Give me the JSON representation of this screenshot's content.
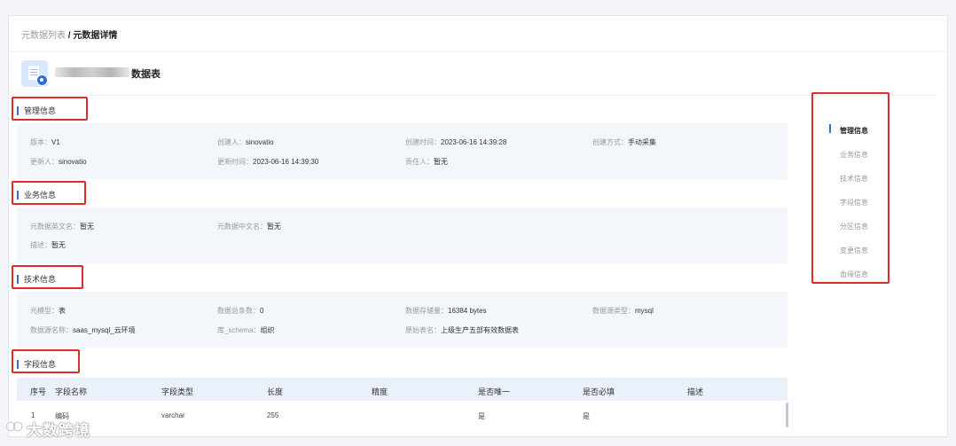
{
  "breadcrumb": {
    "parent": "元数据列表",
    "separator": " / ",
    "current": "元数据详情"
  },
  "title": {
    "suffix": "数据表"
  },
  "sections": {
    "management": {
      "title": "管理信息",
      "rows": [
        [
          {
            "key": "版本：",
            "value": "V1"
          },
          {
            "key": "创建人：",
            "value": "sinovatio"
          },
          {
            "key": "创建时间：",
            "value": "2023-06-16 14:39:28"
          },
          {
            "key": "创建方式：",
            "value": "手动采集"
          }
        ],
        [
          {
            "key": "更新人：",
            "value": "sinovatio"
          },
          {
            "key": "更新时间：",
            "value": "2023-06-16 14:39:30"
          },
          {
            "key": "责任人：",
            "value": "暂无"
          }
        ]
      ]
    },
    "business": {
      "title": "业务信息",
      "rows": [
        [
          {
            "key": "元数据英文名：",
            "value": "暂无"
          },
          {
            "key": "元数据中文名：",
            "value": "暂无"
          }
        ],
        [
          {
            "key": "描述：",
            "value": "暂无"
          }
        ]
      ]
    },
    "technical": {
      "title": "技术信息",
      "rows": [
        [
          {
            "key": "元模型：",
            "value": "表"
          },
          {
            "key": "数据总条数：",
            "value": "0"
          },
          {
            "key": "数据存储量：",
            "value": "16384 bytes"
          },
          {
            "key": "数据源类型：",
            "value": "mysql"
          }
        ],
        [
          {
            "key": "数据源名称：",
            "value": "saas_mysql_云环境"
          },
          {
            "key": "库_schema：",
            "value": "组织"
          },
          {
            "key": "原始表名：",
            "value": "上级生产五部有效数据表"
          }
        ]
      ]
    },
    "fields": {
      "title": "字段信息",
      "columns": [
        "序号",
        "字段名称",
        "字段类型",
        "长度",
        "精度",
        "是否唯一",
        "是否必填",
        "描述"
      ],
      "rows": [
        [
          "1",
          "编码",
          "varchar",
          "255",
          "",
          "是",
          "是",
          ""
        ]
      ]
    }
  },
  "right_nav": {
    "active": "管理信息",
    "items": [
      "管理信息",
      "业务信息",
      "技术信息",
      "字段信息",
      "分区信息",
      "变更信息",
      "血缘信息"
    ]
  },
  "watermark": {
    "text": "大数跨境"
  },
  "colors": {
    "accent": "#2e6fe8",
    "highlight_box": "#e02b2b",
    "section_bg": "#f3f6fa",
    "table_header_bg": "#eaf1fb"
  }
}
